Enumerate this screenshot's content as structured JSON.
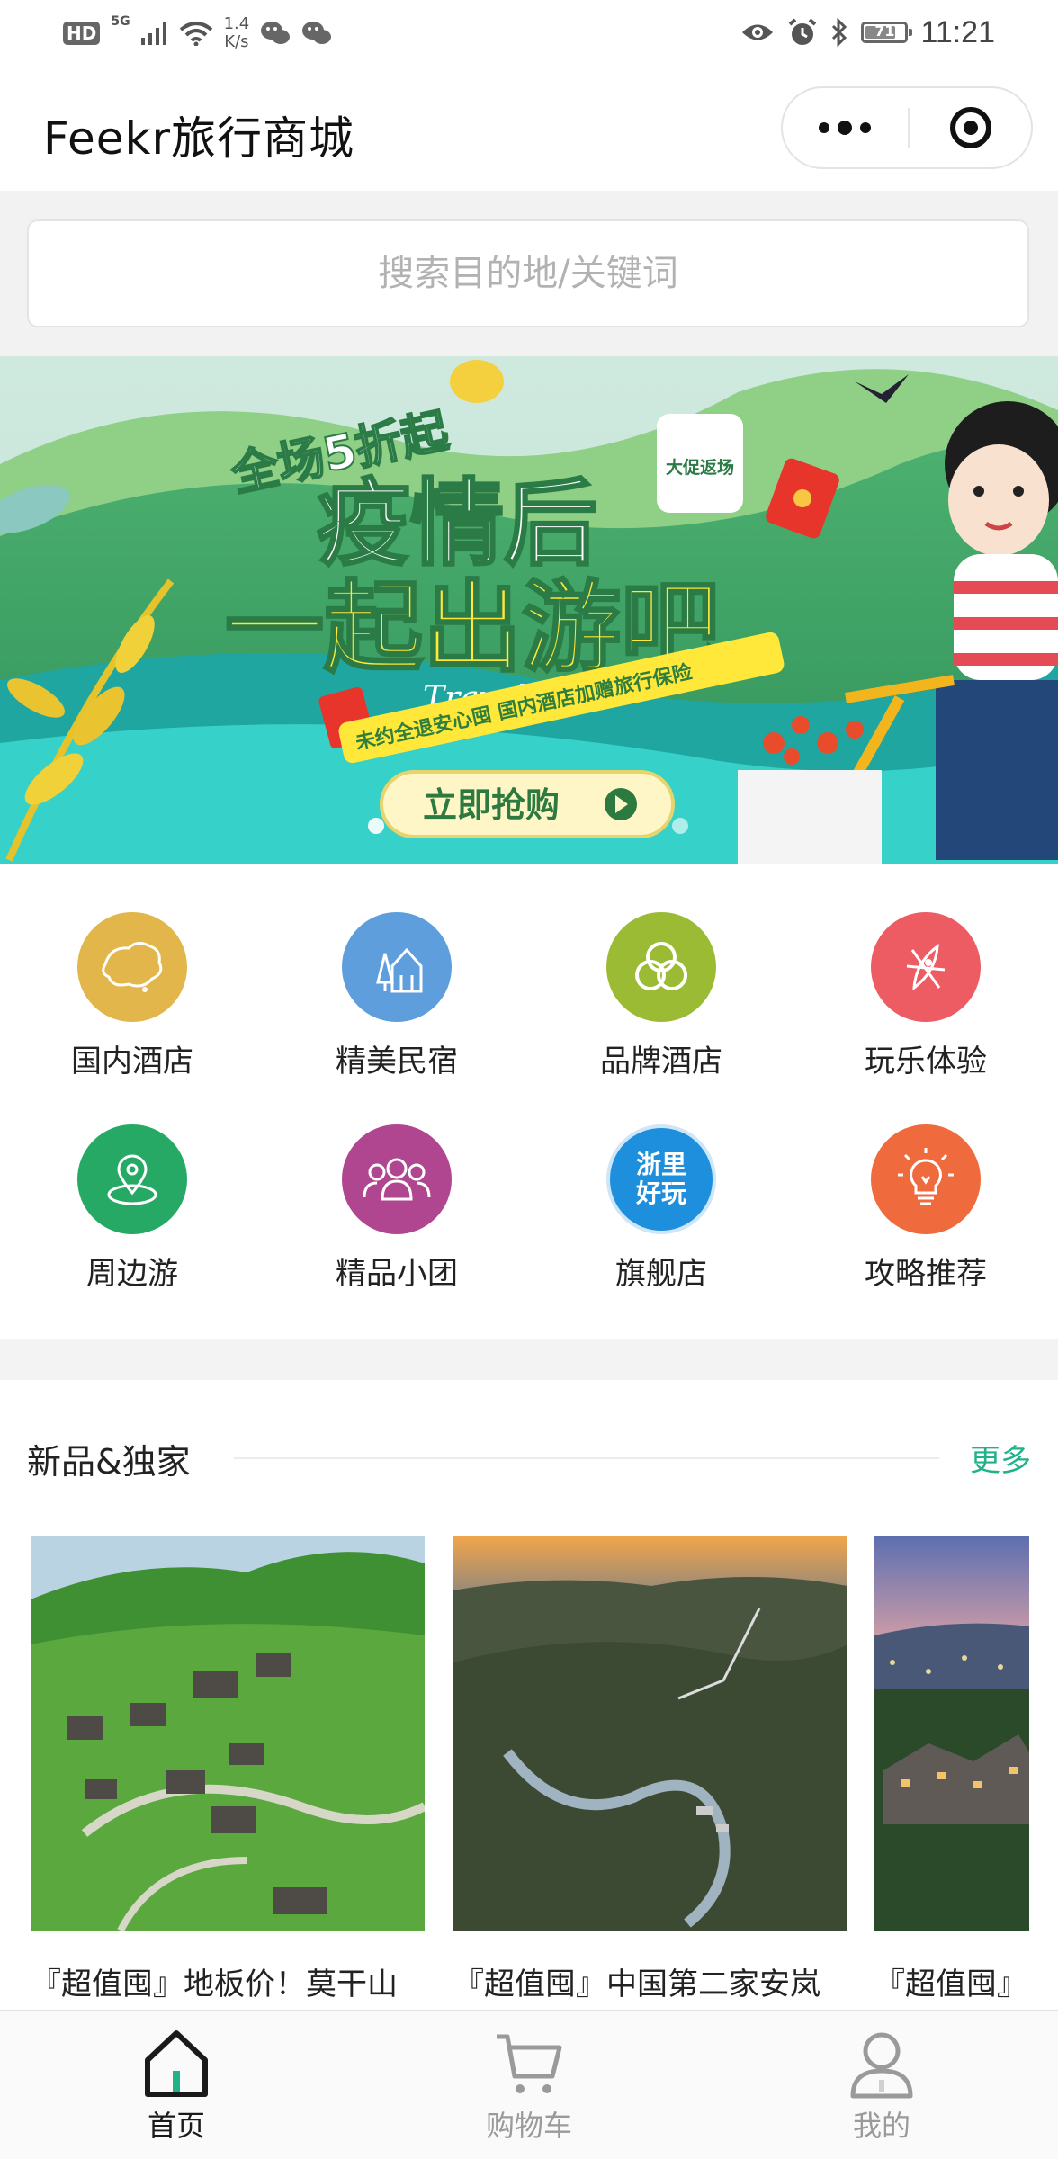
{
  "status_bar": {
    "network_badge": "HD",
    "signal_type": "5G",
    "speed_value": "1.4",
    "speed_unit": "K/s",
    "battery": "71",
    "time": "11:21"
  },
  "header": {
    "title": "Feekr旅行商城"
  },
  "search": {
    "placeholder": "搜索目的地/关键词"
  },
  "banner": {
    "line1": "全场5折起",
    "line2": "疫情后",
    "line3": "一起出游吧",
    "badge": "大促返场",
    "brand": "Travel",
    "subtitle": "未约全退安心囤 国内酒店加赠旅行保险",
    "cta": "立即抢购",
    "dots_count": 2
  },
  "categories": [
    {
      "label": "国内酒店",
      "icon": "china-map-icon",
      "color": "#e2b64a"
    },
    {
      "label": "精美民宿",
      "icon": "house-tree-icon",
      "color": "#5e9edc"
    },
    {
      "label": "品牌酒店",
      "icon": "rings-icon",
      "color": "#9cbb34"
    },
    {
      "label": "玩乐体验",
      "icon": "kayak-icon",
      "color": "#ec5c62"
    },
    {
      "label": "周边游",
      "icon": "location-pin-icon",
      "color": "#25a964"
    },
    {
      "label": "精品小团",
      "icon": "group-icon",
      "color": "#b0468f"
    },
    {
      "label": "旗舰店",
      "icon": "zheli-logo-icon",
      "color": "#1e8fdc",
      "logo_text": "浙里好玩"
    },
    {
      "label": "攻略推荐",
      "icon": "lightbulb-icon",
      "color": "#ef6a3c"
    }
  ],
  "section": {
    "title": "新品&独家",
    "more": "更多",
    "cards": [
      {
        "name": "『超值囤』地板价！莫干山"
      },
      {
        "name": "『超值囤』中国第二家安岚"
      },
      {
        "name": "『超值囤』"
      }
    ]
  },
  "tabbar": {
    "tabs": [
      {
        "label": "首页",
        "active": true
      },
      {
        "label": "购物车",
        "active": false
      },
      {
        "label": "我的",
        "active": false
      }
    ],
    "active_color": "#1a1a1a",
    "inactive_color": "#9a9a9a"
  }
}
